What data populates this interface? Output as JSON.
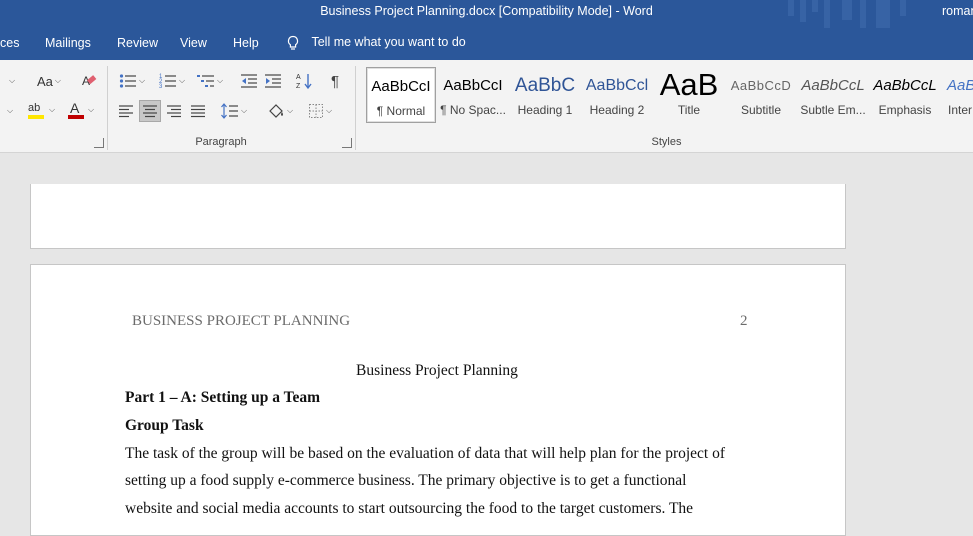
{
  "window": {
    "title": "Business Project Planning.docx [Compatibility Mode]  -  Word",
    "user": "roman"
  },
  "tabs": [
    "ces",
    "Mailings",
    "Review",
    "View",
    "Help"
  ],
  "tell_me": "Tell me what you want to do",
  "ribbon": {
    "font_case_label": "Aa",
    "paragraph_group_label": "Paragraph",
    "styles_group_label": "Styles",
    "font_color": "#c00000",
    "highlight_color": "#ffe600",
    "styles": [
      {
        "sample": "AaBbCcI",
        "name": "¶ Normal"
      },
      {
        "sample": "AaBbCcI",
        "name": "¶ No Spac..."
      },
      {
        "sample": "AaBbC",
        "name": "Heading 1"
      },
      {
        "sample": "AaBbCcl",
        "name": "Heading 2"
      },
      {
        "sample": "AaB",
        "name": "Title"
      },
      {
        "sample": "AaBbCcD",
        "name": "Subtitle"
      },
      {
        "sample": "AaBbCcL",
        "name": "Subtle Em..."
      },
      {
        "sample": "AaBbCcL",
        "name": "Emphasis"
      },
      {
        "sample": "AaBb",
        "name": "Inter"
      }
    ]
  },
  "document": {
    "header_left": "BUSINESS PROJECT PLANNING",
    "page_number": "2",
    "center_title": "Business Project Planning",
    "part_heading": "Part 1 – A: Setting up a Team",
    "group_heading": "Group Task",
    "body_lines": [
      "The task of the group will be based on the evaluation of data that will help plan for the project of",
      "setting up a food supply e-commerce business. The primary objective is to get a functional",
      "website and social media accounts to start outsourcing the food to the target customers. The"
    ]
  }
}
